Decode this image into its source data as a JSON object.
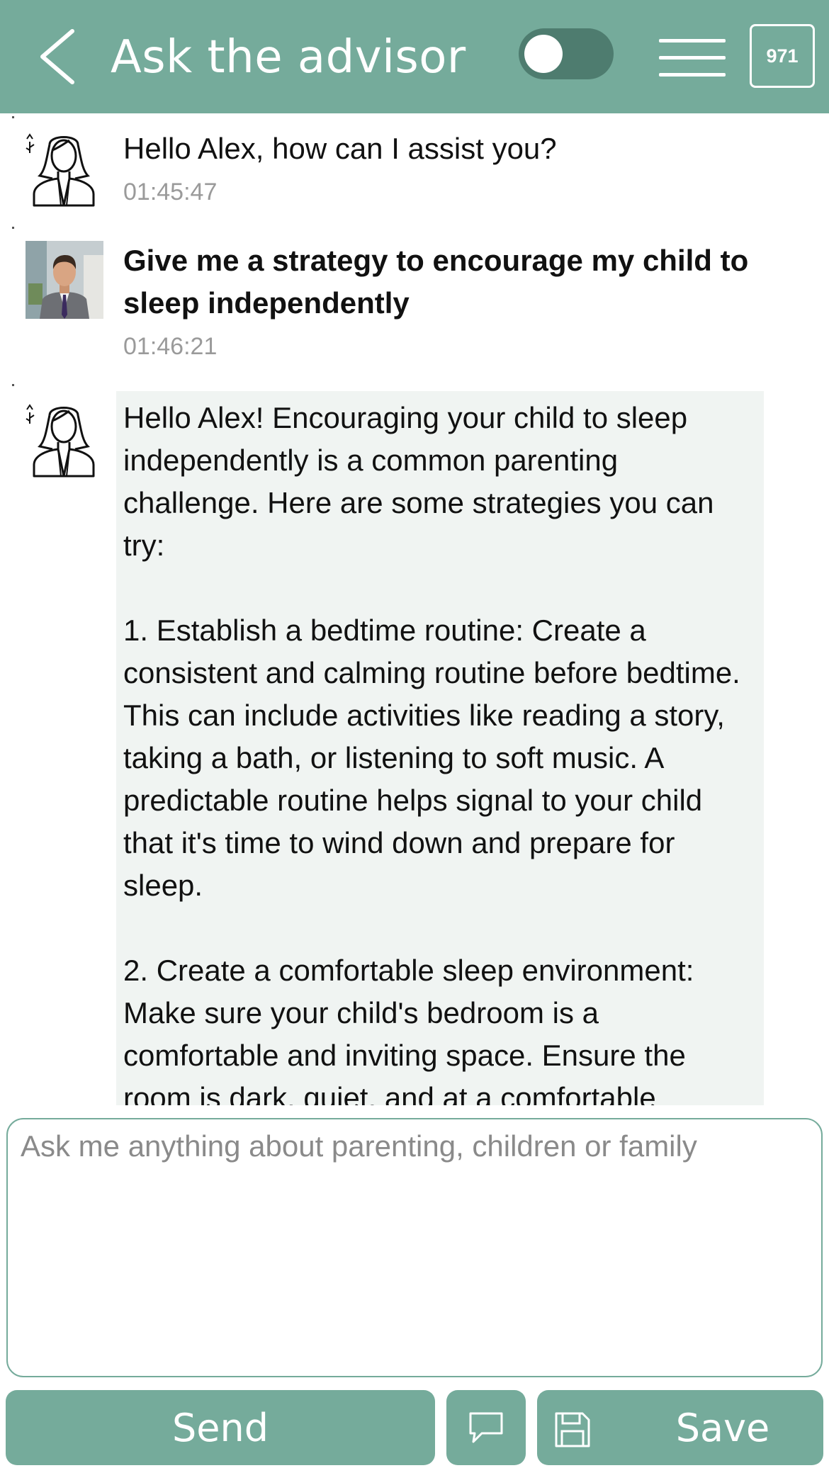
{
  "header": {
    "title": "Ask the advisor",
    "counter": "971",
    "back_icon": "chevron-left-icon",
    "menu_icon": "hamburger-menu-icon",
    "toggle_state": "off"
  },
  "messages": [
    {
      "sender": "advisor",
      "text": "Hello Alex, how can I assist you?",
      "time": "01:45:47"
    },
    {
      "sender": "user",
      "text": "Give me a strategy to encourage my child to sleep independently",
      "time": "01:46:21"
    },
    {
      "sender": "advisor",
      "text": "Hello Alex! Encouraging your child to sleep independently is a common parenting challenge. Here are some strategies you can try:\n\n1. Establish a bedtime routine: Create a consistent and calming routine before bedtime. This can include activities like reading a story, taking a bath, or listening to soft music. A predictable routine helps signal to your child that it's time to wind down and prepare for sleep.\n\n2. Create a comfortable sleep environment: Make sure your child's bedroom is a comfortable and inviting space. Ensure the room is dark, quiet, and at a comfortable"
    }
  ],
  "composer": {
    "placeholder": "Ask me anything about parenting, children or family",
    "value": ""
  },
  "buttons": {
    "send": "Send",
    "save": "Save",
    "chat_icon": "speech-bubble-icon",
    "save_icon": "floppy-disk-icon"
  },
  "colors": {
    "accent": "#75ab9b",
    "toggle_track": "#4e7c6f",
    "reply_background": "#f0f4f2",
    "timestamp": "#9a9a9a"
  }
}
